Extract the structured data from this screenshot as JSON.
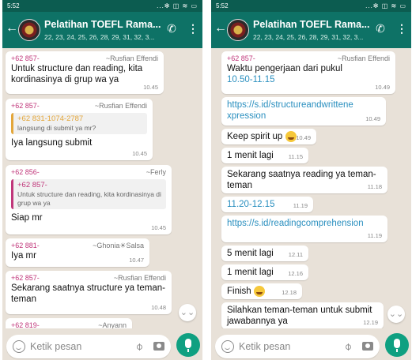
{
  "left": {
    "status": {
      "time": "5:52",
      "icons": "...✻ ◫ ≋ ▭"
    },
    "header": {
      "title": "Pelatihan TOEFL Rama...",
      "subtitle": "22, 23, 24, 25, 26, 28, 29, 31, 32, 3..."
    },
    "messages": [
      {
        "phone": "+62 857-",
        "name": "~Rusfian Effendi",
        "text": "Untuk structure dan reading, kita kordinasinya di grup wa ya",
        "time": "10.45"
      },
      {
        "phone": "+62 857-",
        "name": "~Rusfian Effendi",
        "quote_phone": "+62 831-1074-2787",
        "quote_text": "langsung di submit ya mr?",
        "text": "Iya langsung submit",
        "time": "10.45"
      },
      {
        "phone": "+62 856-",
        "name": "~Ferly",
        "quote_phone": "+62 857-",
        "quote_text": "Untuk structure dan reading, kita kordinasinya di grup wa ya",
        "text": "Siap mr",
        "time": "10.45"
      },
      {
        "phone": "+62 881-",
        "name": "~Ghonia☀Salsa",
        "text": "Iya mr",
        "time": "10.47"
      },
      {
        "phone": "+62 857-",
        "name": "~Rusfian Effendi",
        "text": "Sekarang saatnya structure ya teman-teman",
        "time": "10.48"
      },
      {
        "phone": "+62 819-",
        "name": "~Anyann"
      }
    ],
    "input": {
      "placeholder": "Ketik pesan"
    }
  },
  "right": {
    "status": {
      "time": "5:52",
      "icons": "...✻ ◫ ≋ ▭"
    },
    "header": {
      "title": "Pelatihan TOEFL Rama...",
      "subtitle": "22, 23, 24, 25, 26, 28, 29, 31, 32, 3..."
    },
    "messages": [
      {
        "phone": "+62 857-",
        "name": "~Rusfian Effendi",
        "text": "Waktu pengerjaan dari pukul",
        "text2": "10.50-11.15",
        "time": "10.49"
      },
      {
        "text": "https://s.id/structureandwrittenexpression",
        "time": "10.49"
      },
      {
        "text": "Keep spirit up",
        "time": "10.49"
      },
      {
        "text": "1 menit lagi",
        "time": "11.15"
      },
      {
        "text": "Sekarang saatnya reading ya teman-teman",
        "time": "11.18"
      },
      {
        "text": "11.20-12.15",
        "time": "11.19"
      },
      {
        "text": "https://s.id/readingcomprehension",
        "time": "11.19"
      },
      {
        "text": "5 menit lagi",
        "time": "12.11"
      },
      {
        "text": "1 menit lagi",
        "time": "12.16"
      },
      {
        "text": "Finish",
        "time": "12.18"
      },
      {
        "text": "Silahkan teman-teman untuk submit jawabannya ya",
        "time": "12.19"
      }
    ],
    "input": {
      "placeholder": "Ketik pesan"
    }
  },
  "icons": {
    "back": "back-arrow-icon",
    "call": "add-call-icon",
    "menu": "more-vert-icon",
    "scroll": "chevron-double-down-icon",
    "emoji": "emoji-icon",
    "attach": "attach-icon",
    "camera": "camera-icon",
    "mic": "mic-icon"
  },
  "colors": {
    "header": "#0e7266",
    "status_bar": "#0c5c50",
    "chat_bg": "#e8e1d8",
    "sender_phone": "#c0367a",
    "link": "#2a8fbf",
    "mic_button": "#0fa081"
  }
}
